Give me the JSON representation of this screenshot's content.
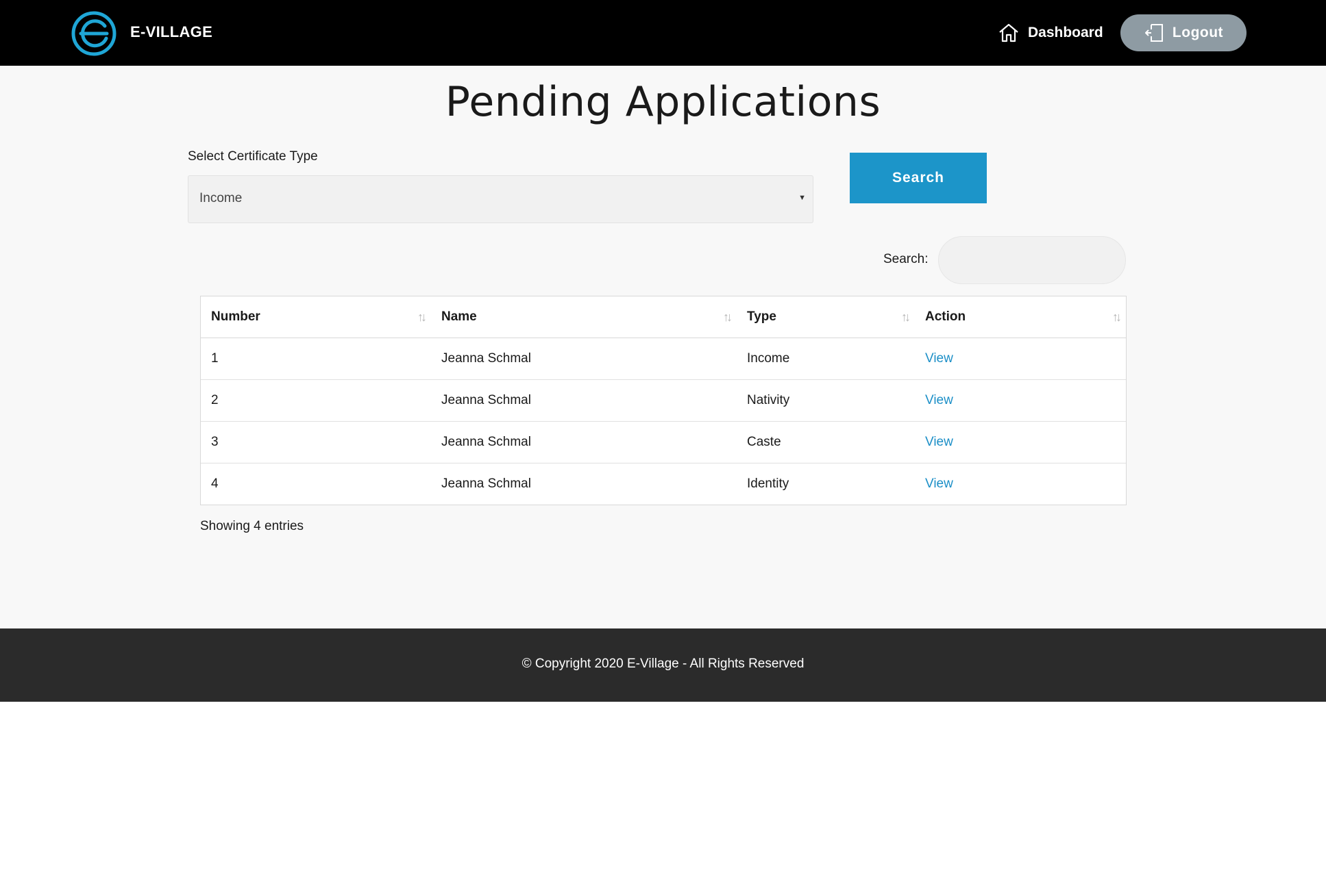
{
  "brand": {
    "name": "E-VILLAGE",
    "logo_icon": "e-logo-icon",
    "accent": "#1fa6d6"
  },
  "nav": {
    "dashboard_label": "Dashboard",
    "logout_label": "Logout"
  },
  "page": {
    "title": "Pending Applications"
  },
  "filter": {
    "label": "Select Certificate Type",
    "selected": "Income",
    "search_button": "Search"
  },
  "table_search": {
    "label": "Search:",
    "value": ""
  },
  "table": {
    "columns": [
      "Number",
      "Name",
      "Type",
      "Action"
    ],
    "rows": [
      {
        "number": "1",
        "name": "Jeanna Schmal",
        "type": "Income",
        "action": "View"
      },
      {
        "number": "2",
        "name": "Jeanna Schmal",
        "type": "Nativity",
        "action": "View"
      },
      {
        "number": "3",
        "name": "Jeanna Schmal",
        "type": "Caste",
        "action": "View"
      },
      {
        "number": "4",
        "name": "Jeanna Schmal",
        "type": "Identity",
        "action": "View"
      }
    ],
    "info": "Showing 4 entries"
  },
  "footer": {
    "copyright": "© Copyright 2020 E-Village - All Rights Reserved"
  },
  "colors": {
    "navbar": "#000000",
    "logout_button": "#8e9ba3",
    "primary_button": "#1c95c9",
    "link": "#1c8fc7",
    "footer": "#2b2b2b"
  }
}
